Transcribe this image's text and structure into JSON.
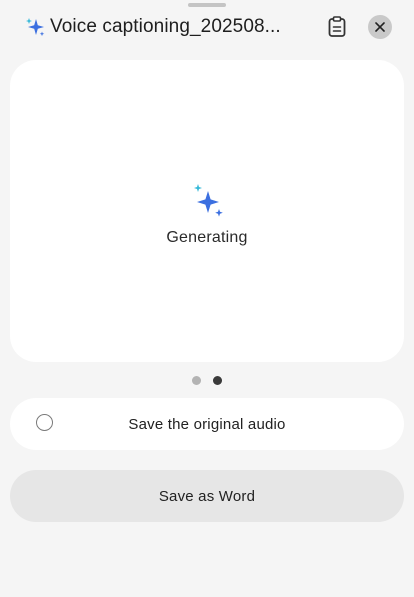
{
  "header": {
    "title": "Voice captioning_202508...",
    "title_icon": "ai-sparkle-icon",
    "actions": [
      {
        "icon": "clipboard-icon"
      },
      {
        "icon": "close-icon"
      }
    ]
  },
  "card": {
    "icon": "ai-sparkle-icon",
    "status_text": "Generating"
  },
  "pager": {
    "count": 2,
    "active_index": 1
  },
  "option": {
    "label": "Save the original audio",
    "checked": false
  },
  "primary_button": {
    "label": "Save as Word"
  },
  "colors": {
    "sparkle_blue": "#3b6fe0",
    "sparkle_cyan": "#35b8d8",
    "background": "#f5f5f5",
    "card": "#ffffff",
    "button": "#e6e6e6"
  }
}
